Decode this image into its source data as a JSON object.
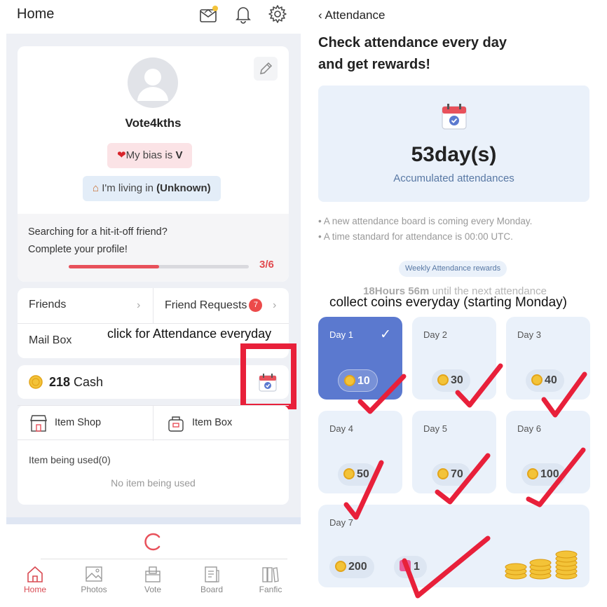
{
  "left": {
    "header": {
      "title": "Home"
    },
    "profile": {
      "username": "Vote4kths",
      "bias_prefix": "My bias is ",
      "bias_value": "V",
      "living_prefix": "I'm living in ",
      "living_value": "(Unknown)",
      "prompt_line1": "Searching for a hit-it-off friend?",
      "prompt_line2": "Complete your profile!",
      "progress_label": "3/6",
      "progress_fraction": 0.5
    },
    "menu": {
      "friends": "Friends",
      "friend_requests": "Friend Requests",
      "friend_requests_badge": "7",
      "mailbox": "Mail Box"
    },
    "annotation_attendance": "click for Attendance everyday",
    "cash": {
      "amount": "218",
      "unit": " Cash"
    },
    "items": {
      "shop": "Item Shop",
      "box": "Item Box",
      "used": "Item being used(0)",
      "empty": "No item being used"
    },
    "tabs": [
      {
        "label": "Home",
        "active": true
      },
      {
        "label": "Photos",
        "active": false
      },
      {
        "label": "Vote",
        "active": false
      },
      {
        "label": "Board",
        "active": false
      },
      {
        "label": "Fanfic",
        "active": false
      }
    ]
  },
  "right": {
    "back_label": "Attendance",
    "headline_line1": "Check attendance every day",
    "headline_line2": "and get rewards!",
    "days_count": "53day(s)",
    "accumulated_label": "Accumulated attendances",
    "note1": "A new attendance board is coming every Monday.",
    "note2": "A time standard for attendance is 00:00 UTC.",
    "weekly_pill": "Weekly Attendance rewards",
    "next_time": "18Hours 56m",
    "next_suffix": " until the next attendance",
    "annotation_coins": "collect coins everyday (starting Monday)",
    "days": [
      {
        "label": "Day 1",
        "reward": "10",
        "done": true
      },
      {
        "label": "Day 2",
        "reward": "30",
        "done": false
      },
      {
        "label": "Day 3",
        "reward": "40",
        "done": false
      },
      {
        "label": "Day 4",
        "reward": "50",
        "done": false
      },
      {
        "label": "Day 5",
        "reward": "70",
        "done": false
      },
      {
        "label": "Day 6",
        "reward": "100",
        "done": false
      }
    ],
    "day7": {
      "label": "Day 7",
      "coins": "200",
      "gift": "1"
    }
  },
  "colors": {
    "accent_red": "#e8515b",
    "annotation_red": "#e8203a",
    "done_blue": "#5b79cf",
    "panel_blue": "#eaf1fa"
  }
}
